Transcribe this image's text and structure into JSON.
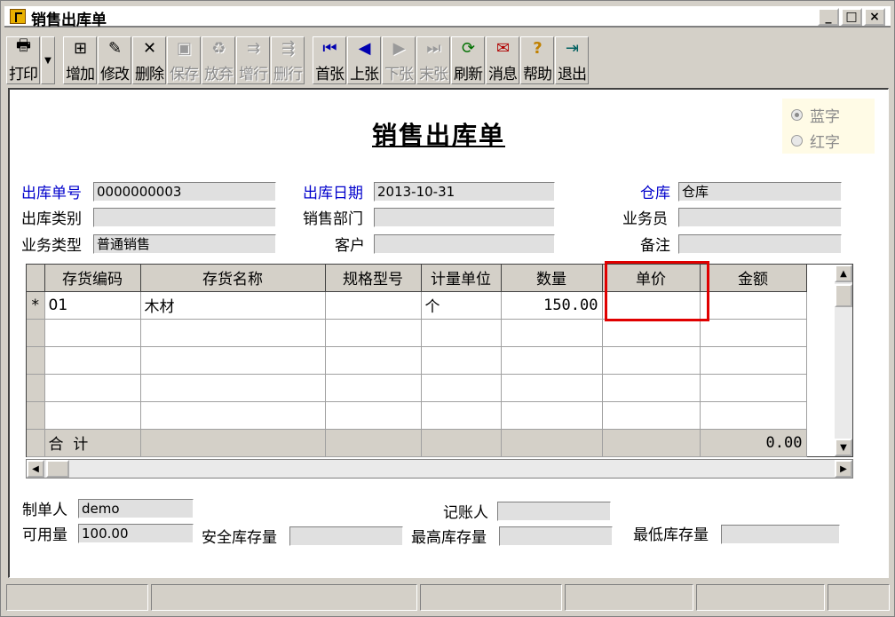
{
  "window": {
    "title": "销售出库单",
    "controls": {
      "minimize": "_",
      "maximize": "□",
      "close": "×"
    }
  },
  "toolbar": {
    "print": "打印",
    "add": "增加",
    "edit": "修改",
    "delete": "删除",
    "save": "保存",
    "discard": "放弃",
    "add_row": "增行",
    "delete_row": "删行",
    "first": "首张",
    "prev": "上张",
    "next": "下张",
    "last": "末张",
    "refresh": "刷新",
    "message": "消息",
    "help": "帮助",
    "exit": "退出"
  },
  "form": {
    "doc_title": "销售出库单",
    "radio_blue": "蓝字",
    "radio_red": "红字",
    "out_no_label": "出库单号",
    "out_no_value": "0000000003",
    "out_date_label": "出库日期",
    "out_date_value": "2013-10-31",
    "warehouse_label": "仓库",
    "warehouse_value": "仓库",
    "out_type_label": "出库类别",
    "out_type_value": "",
    "sales_dept_label": "销售部门",
    "sales_dept_value": "",
    "salesman_label": "业务员",
    "salesman_value": "",
    "biz_type_label": "业务类型",
    "biz_type_value": "普通销售",
    "customer_label": "客户",
    "customer_value": "",
    "remark_label": "备注",
    "remark_value": ""
  },
  "grid": {
    "columns": [
      "存货编码",
      "存货名称",
      "规格型号",
      "计量单位",
      "数量",
      "单价",
      "金额"
    ],
    "rows": [
      {
        "marker": "*",
        "code": "01",
        "name": "木材",
        "spec": "",
        "unit": "个",
        "qty": "150.00",
        "price": "",
        "amount": ""
      }
    ],
    "total_label": "合  计",
    "total_amount": "0.00"
  },
  "footer": {
    "maker_label": "制单人",
    "maker_value": "demo",
    "bookkeeper_label": "记账人",
    "bookkeeper_value": "",
    "available_label": "可用量",
    "available_value": "100.00",
    "safety_label": "安全库存量",
    "safety_value": "",
    "max_label": "最高库存量",
    "max_value": "",
    "min_label": "最低库存量",
    "min_value": ""
  },
  "colors": {
    "highlight": "#e00000",
    "label_blue": "#0000cc",
    "field_bg": "#e0e0e0",
    "chrome": "#d4d0c8"
  }
}
